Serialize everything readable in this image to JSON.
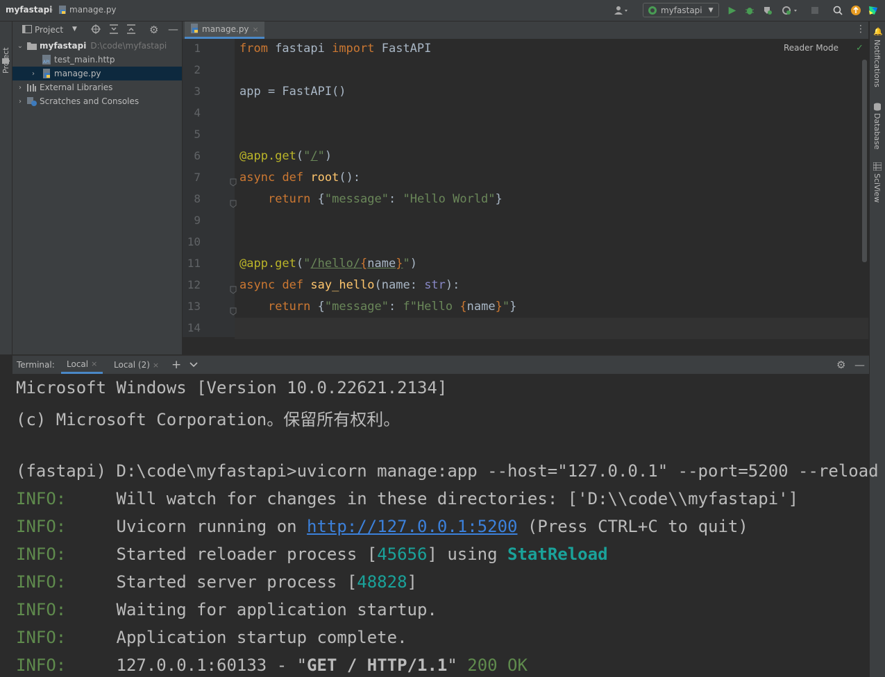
{
  "titlebar": {
    "project": "myfastapi",
    "file": "manage.py",
    "run_config": "myfastapi"
  },
  "project_panel": {
    "title": "Project",
    "items": [
      {
        "label": "myfastapi",
        "path": "D:\\code\\myfastapi"
      },
      {
        "label": "test_main.http"
      },
      {
        "label": "manage.py"
      },
      {
        "label": "External Libraries"
      },
      {
        "label": "Scratches and Consoles"
      }
    ]
  },
  "editor": {
    "tab": "manage.py",
    "reader_mode": "Reader Mode",
    "line_numbers": [
      "1",
      "2",
      "3",
      "4",
      "5",
      "6",
      "7",
      "8",
      "9",
      "10",
      "11",
      "12",
      "13",
      "14"
    ],
    "lines": [
      "from fastapi import FastAPI",
      "",
      "app = FastAPI()",
      "",
      "",
      "@app.get(\"/\")",
      "async def root():",
      "    return {\"message\": \"Hello World\"}",
      "",
      "",
      "@app.get(\"/hello/{name}\")",
      "async def say_hello(name: str):",
      "    return {\"message\": f\"Hello {name}\"}",
      ""
    ]
  },
  "right_strip": {
    "notifications": "Notifications",
    "database": "Database",
    "sciview": "SciView"
  },
  "left_strip": {
    "project": "Project"
  },
  "terminal": {
    "label": "Terminal:",
    "tabs": [
      "Local",
      "Local (2)"
    ],
    "lines": [
      "Microsoft Windows [Version 10.0.22621.2134]",
      "(c) Microsoft Corporation。保留所有权利。",
      "",
      "(fastapi) D:\\code\\myfastapi>uvicorn manage:app --host=\"127.0.0.1\" --port=5200 --reload"
    ],
    "info_prefix": "INFO:",
    "info_lines": {
      "watch": "Will watch for changes in these directories: ['D:\\\\code\\\\myfastapi']",
      "running_pre": "Uvicorn running on ",
      "running_link": "http://127.0.0.1:5200",
      "running_post": " (Press CTRL+C to quit)",
      "reloader_pre": "Started reloader process [",
      "reloader_pid": "45656",
      "reloader_mid": "] using ",
      "reloader_name": "StatReload",
      "server_pre": "Started server process [",
      "server_pid": "48828",
      "server_post": "]",
      "waiting": "Waiting for application startup.",
      "complete": "Application startup complete.",
      "req_pre": "127.0.0.1:60133 - \"",
      "req_method": "GET / HTTP/1.1",
      "req_mid": "\" ",
      "req_status": "200 OK"
    }
  }
}
